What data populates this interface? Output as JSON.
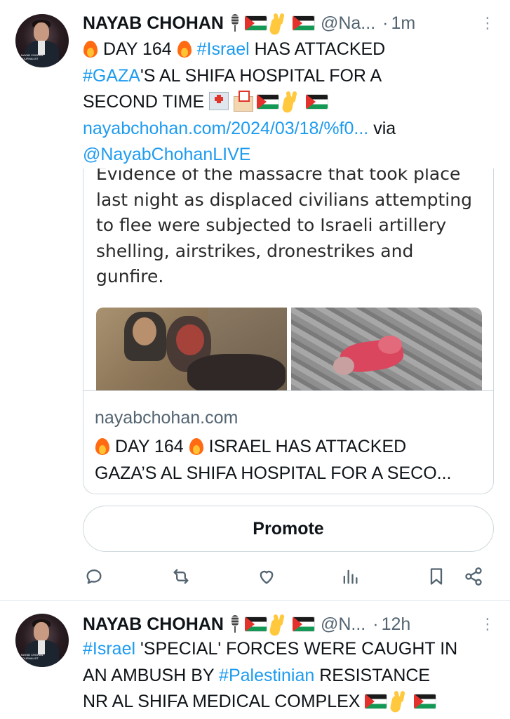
{
  "tweets": [
    {
      "author": "NAYAB CHOHAN",
      "handle": "@Na...",
      "time": "1m",
      "text": {
        "fire": "DAY 164",
        "hashtag1": "#Israel",
        "seg1": " HAS ATTACKED",
        "hashtag2": "#GAZA",
        "seg2": "'S AL SHIFA HOSPITAL FOR A",
        "seg3": "SECOND TIME",
        "link": "nayabchohan.com/2024/03/18/%f0...",
        "via": " via",
        "mention": "@NayabChohanLIVE"
      },
      "media_text": [
        "Evidence of the massacre that took place",
        "last night as displaced civilians attempting",
        "to flee were subjected to Israeli artillery",
        "shelling, airstrikes, dronestrikes and",
        "gunfire."
      ],
      "card": {
        "domain": "nayabchohan.com",
        "title_line1": "DAY 164",
        "title_line1b": "ISRAEL HAS ATTACKED",
        "title_line2": "GAZA’S AL SHIFA HOSPITAL FOR A SECO..."
      },
      "promote_label": "Promote"
    },
    {
      "author": "NAYAB CHOHAN",
      "handle": "@N...",
      "time": "12h",
      "text": {
        "hashtag1": "#Israel",
        "seg1": " 'SPECIAL' FORCES WERE CAUGHT IN",
        "seg2": "AN AMBUSH BY ",
        "hashtag2": "#Palestinian",
        "seg3": " RESISTANCE",
        "seg4": "NR AL SHIFA MEDICAL COMPLEX"
      }
    }
  ],
  "ui": {
    "dot": "·",
    "more": "⋮",
    "avatar_caption": "NAYAB CHOHAN JOURNALIST"
  },
  "icons": [
    "reply-icon",
    "retweet-icon",
    "like-icon",
    "views-icon",
    "bookmark-icon",
    "share-icon"
  ],
  "colors": {
    "link": "#1d9bf0",
    "secondary": "#536471",
    "border": "#cfd9de"
  }
}
